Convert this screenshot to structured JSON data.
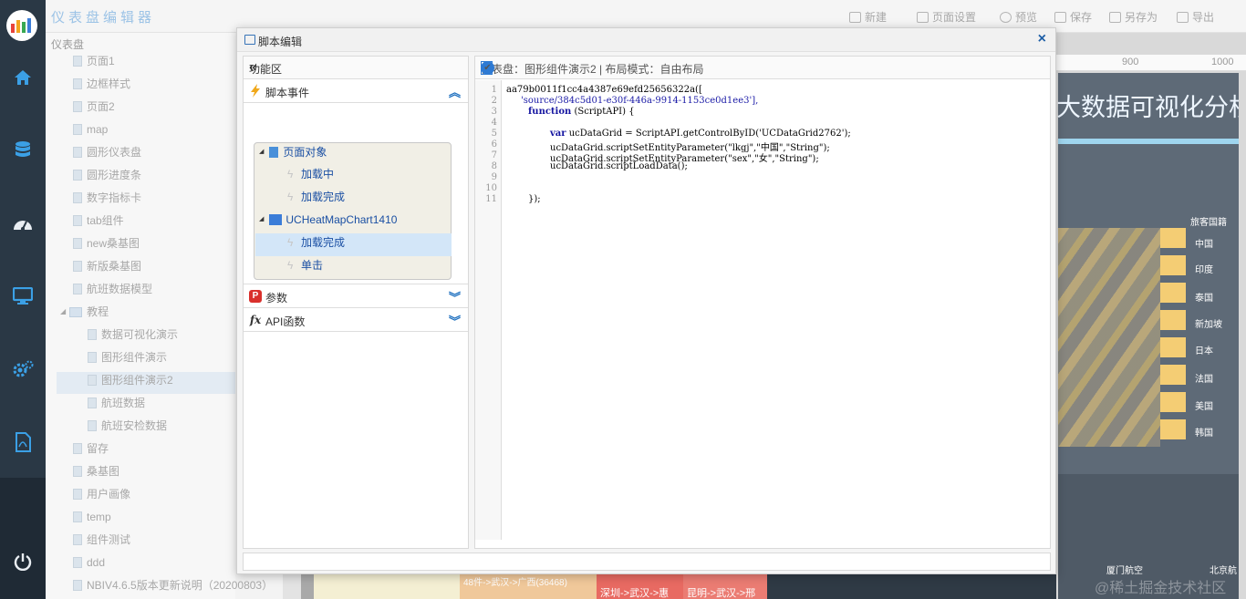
{
  "app": {
    "title": "仪表盘编辑器"
  },
  "toolbar": {
    "new": "新建",
    "page_settings": "页面设置",
    "preview": "预览",
    "save": "保存",
    "save_as": "另存为",
    "export": "导出"
  },
  "tree": {
    "breadcrumb": "仪表盘",
    "items": [
      "页面1",
      "边框样式",
      "页面2",
      "map",
      "圆形仪表盘",
      "圆形进度条",
      "数字指标卡",
      "tab组件",
      "new桑基图",
      "新版桑基图",
      "航班数据模型"
    ],
    "folder": "教程",
    "children": [
      "数据可视化演示",
      "图形组件演示",
      "图形组件演示2",
      "航班数据",
      "航班安检数据"
    ],
    "after": [
      "留存",
      "桑基图",
      "用户画像",
      "temp",
      "组件测试",
      "ddd",
      "NBIV4.6.5版本更新说明（20200803）"
    ]
  },
  "canvas": {
    "ruler": [
      "900",
      "1000"
    ],
    "title": "大数据可视化分析",
    "legend_header": "旅客国籍",
    "countries": [
      "中国",
      "印度",
      "泰国",
      "新加坡",
      "日本",
      "法国",
      "美国",
      "韩国"
    ],
    "cities": [
      "厦门航空",
      "北京航"
    ],
    "strip_text": "48件->武汉->广西(36468)",
    "strip_text2": "深圳->武汉->惠",
    "strip_text3": "昆明->武汉->邢",
    "watermark": "@稀土掘金技术社区"
  },
  "modal": {
    "title": "脚本编辑",
    "left": {
      "header": "功能区",
      "script_events": "脚本事件",
      "page_object": "页面对象",
      "loading": "加载中",
      "loaded": "加载完成",
      "component": "UCHeatMapChart1410",
      "comp_loaded": "加载完成",
      "click": "单击",
      "params": "参数",
      "api": "API函数"
    },
    "right": {
      "header": "仪表盘：图形组件演示2 | 布局模式：自由布局",
      "lines": [
        "1",
        "2",
        "3",
        "4",
        "5",
        "6",
        "7",
        "8",
        "9",
        "10",
        "11"
      ],
      "code": {
        "l1": "aa79b0011f1cc4a4387e69efd25656322a([",
        "l2": "'source/384c5d01-e30f-446a-9914-1153ce0d1ee3'],",
        "l3_kw": "function",
        "l3": " (ScriptAPI) {",
        "l5_kw": "var",
        "l5": " ucDataGrid = ScriptAPI.getControlByID('UCDataGrid2762');",
        "l6": "ucDataGrid.scriptSetEntityParameter(\"lkgj\",\"中国\",\"String\");",
        "l7": "ucDataGrid.scriptSetEntityParameter(\"sex\",\"女\",\"String\");",
        "l8": "ucDataGrid.scriptLoadData();",
        "l11": "});"
      }
    }
  }
}
